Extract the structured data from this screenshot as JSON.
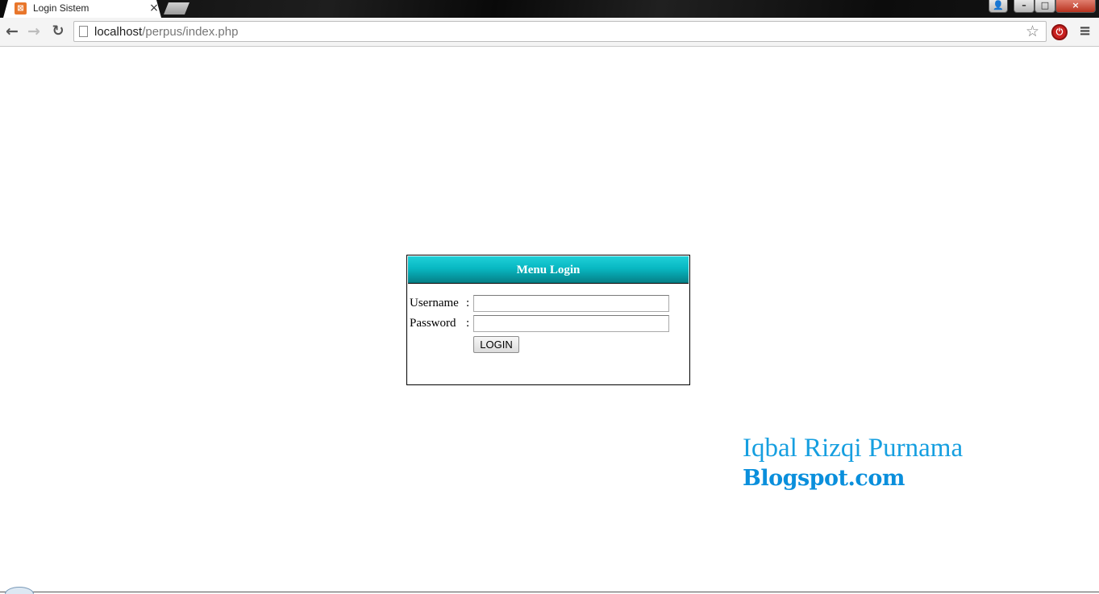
{
  "browser": {
    "tab": {
      "title": "Login Sistem",
      "favicon_glyph": "⊠",
      "close_glyph": "×"
    },
    "window_controls": {
      "user_glyph": "👤",
      "minimize_glyph": "–",
      "maximize_glyph": "□",
      "close_glyph": "×"
    },
    "nav": {
      "back_glyph": "←",
      "forward_glyph": "→",
      "reload_glyph": "↻"
    },
    "address": {
      "host": "localhost",
      "path": "/perpus/index.php"
    },
    "icons": {
      "bookmark": "star-icon",
      "extension": "stop-icon",
      "menu": "menu-icon"
    },
    "star_glyph": "☆",
    "extension_glyph": "⏻",
    "menu_glyph": "≡"
  },
  "login": {
    "title": "Menu Login",
    "username_label": "Username",
    "password_label": "Password",
    "colon": ":",
    "username_value": "",
    "password_value": "",
    "submit_label": "LOGIN",
    "header_color": "#08b8c2"
  },
  "watermark": {
    "name": "Iqbal Rizqi Purnama",
    "site": "Blogspot.com",
    "color": "#169fe0"
  }
}
